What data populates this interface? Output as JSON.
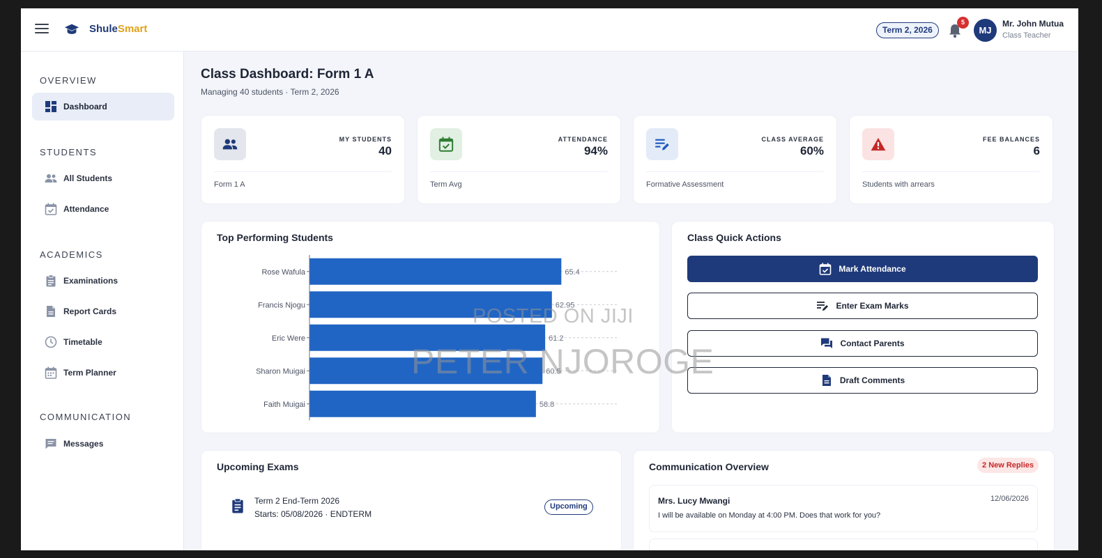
{
  "brand": {
    "part1": "Shule",
    "part2": "Smart"
  },
  "header": {
    "term": "Term 2, 2026",
    "notifications": "5",
    "avatar_initials": "MJ",
    "user_name": "Mr. John Mutua",
    "user_role": "Class Teacher"
  },
  "sidebar": {
    "sections": [
      {
        "title": "OVERVIEW",
        "items": [
          {
            "label": "Dashboard",
            "icon": "dashboard-icon",
            "active": true
          }
        ]
      },
      {
        "title": "STUDENTS",
        "items": [
          {
            "label": "All Students",
            "icon": "users-icon"
          },
          {
            "label": "Attendance",
            "icon": "calendar-check-icon"
          }
        ]
      },
      {
        "title": "ACADEMICS",
        "items": [
          {
            "label": "Examinations",
            "icon": "clipboard-icon"
          },
          {
            "label": "Report Cards",
            "icon": "document-icon"
          },
          {
            "label": "Timetable",
            "icon": "clock-icon"
          },
          {
            "label": "Term Planner",
            "icon": "calendar-icon"
          }
        ]
      },
      {
        "title": "COMMUNICATION",
        "items": [
          {
            "label": "Messages",
            "icon": "message-icon"
          }
        ]
      }
    ]
  },
  "page": {
    "title": "Class Dashboard: Form 1 A",
    "subtitle": "Managing 40 students · Term 2, 2026"
  },
  "stats": [
    {
      "label": "MY STUDENTS",
      "value": "40",
      "foot": "Form 1 A",
      "icon": "users-icon",
      "bg": "#e3e6ec",
      "fg": "#1f3a7a"
    },
    {
      "label": "ATTENDANCE",
      "value": "94%",
      "foot": "Term Avg",
      "icon": "calendar-check-icon",
      "bg": "#e2efe3",
      "fg": "#2e7d32"
    },
    {
      "label": "CLASS AVERAGE",
      "value": "60%",
      "foot": "Formative Assessment",
      "icon": "edit-list-icon",
      "bg": "#e3ebf8",
      "fg": "#1f5bbf"
    },
    {
      "label": "FEE BALANCES",
      "value": "6",
      "foot": "Students with arrears",
      "icon": "warning-icon",
      "bg": "#fbe3e3",
      "fg": "#c62828"
    }
  ],
  "chart_title": "Top Performing Students",
  "chart_data": {
    "type": "bar",
    "orientation": "horizontal",
    "categories": [
      "Rose Wafula",
      "Francis Njogu",
      "Eric Were",
      "Sharon Muigai",
      "Faith Muigai"
    ],
    "values": [
      65.4,
      62.95,
      61.2,
      60.5,
      58.8
    ],
    "value_labels": [
      "65.4",
      "62.95",
      "61.2",
      "60.5",
      "58.8"
    ],
    "xlim": [
      0,
      80
    ],
    "color": "#2165c4",
    "grid": true
  },
  "actions": {
    "title": "Class Quick Actions",
    "buttons": [
      {
        "label": "Mark Attendance",
        "icon": "calendar-check-icon",
        "primary": true
      },
      {
        "label": "Enter Exam Marks",
        "icon": "edit-list-icon"
      },
      {
        "label": "Contact Parents",
        "icon": "chat-icon"
      },
      {
        "label": "Draft Comments",
        "icon": "document-icon"
      }
    ]
  },
  "exams": {
    "title": "Upcoming Exams",
    "items": [
      {
        "name": "Term 2 End-Term 2026",
        "meta": "Starts: 05/08/2026 · ENDTERM",
        "status": "Upcoming"
      }
    ]
  },
  "communication": {
    "title": "Communication Overview",
    "badge": "2 New Replies",
    "messages": [
      {
        "from": "Mrs. Lucy Mwangi",
        "date": "12/06/2026",
        "text": "I will be available on Monday at 4:00 PM. Does that work for you?"
      }
    ]
  },
  "watermark": {
    "line1": "POSTED ON JIJI",
    "line2": "PETER NJOROGE"
  }
}
